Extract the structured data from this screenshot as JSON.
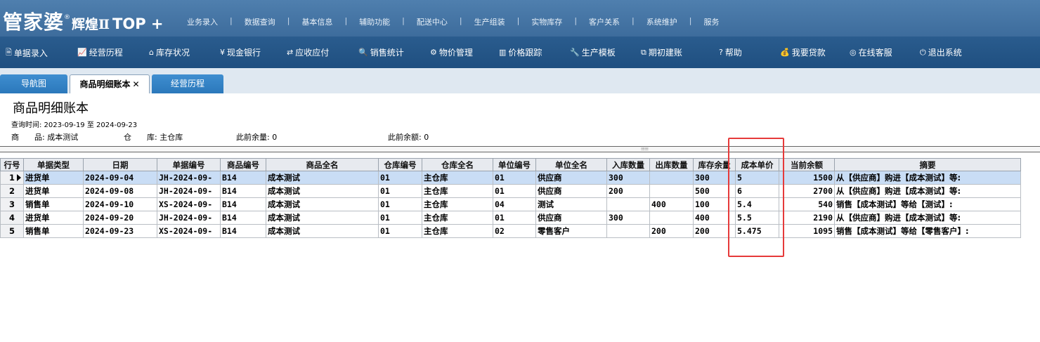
{
  "brand": {
    "main": "管家婆",
    "reg": "®",
    "sub": "辉煌Ⅱ",
    "top": "TOP +"
  },
  "topmenu": [
    "业务录入",
    "数据查询",
    "基本信息",
    "辅助功能",
    "配送中心",
    "生产组装",
    "实物库存",
    "客户关系",
    "系统维护",
    "服务"
  ],
  "toolbar": [
    {
      "icon": "document-icon",
      "glyph": "🗎",
      "label": "单据录入"
    },
    {
      "icon": "line-chart-icon",
      "glyph": "📈",
      "label": "经营历程"
    },
    {
      "icon": "home-icon",
      "glyph": "⌂",
      "label": "库存状况"
    },
    {
      "icon": "yen-icon",
      "glyph": "¥",
      "label": "现金银行"
    },
    {
      "icon": "exchange-icon",
      "glyph": "⇄",
      "label": "应收应付"
    },
    {
      "icon": "search-icon",
      "glyph": "🔍",
      "label": "销售统计"
    },
    {
      "icon": "gear-icon",
      "glyph": "⚙",
      "label": "物价管理"
    },
    {
      "icon": "bar-chart-icon",
      "glyph": "▥",
      "label": "价格跟踪"
    },
    {
      "icon": "wrench-icon",
      "glyph": "🔧",
      "label": "生产模板"
    },
    {
      "icon": "external-link-icon",
      "glyph": "⧉",
      "label": "期初建账"
    },
    {
      "icon": "help-icon",
      "glyph": "?",
      "label": "帮助"
    },
    {
      "icon": "money-bag-icon",
      "glyph": "💰",
      "label": "我要贷款"
    },
    {
      "icon": "support-icon",
      "glyph": "◎",
      "label": "在线客服"
    },
    {
      "icon": "power-icon",
      "glyph": "⏻",
      "label": "退出系统"
    }
  ],
  "tabs": [
    {
      "label": "导航图",
      "close": ""
    },
    {
      "label": "商品明细账本",
      "close": "✕"
    },
    {
      "label": "经营历程",
      "close": ""
    }
  ],
  "report": {
    "title": "商品明细账本",
    "query_time": "查询时间: 2023-09-19 至 2024-09-23",
    "product": "商　　品: 成本测试",
    "warehouse": "仓　　库: 主仓库",
    "prev_qty": "此前余量: 0",
    "prev_amount": "此前余额: 0",
    "grip": "⁝⁝⁝⁝⁝⁝⁝⁝ ⁝⁝⁝⁝⁝⁝⁝⁝"
  },
  "grid": {
    "headers": [
      "行号",
      "单据类型",
      "日期",
      "单据编号",
      "商品编号",
      "商品全名",
      "仓库编号",
      "仓库全名",
      "单位编号",
      "单位全名",
      "入库数量",
      "出库数量",
      "库存余量",
      "成本单价",
      "当前余额",
      "摘要"
    ],
    "rows": [
      [
        "1",
        "进货单",
        "2024-09-04",
        "JH-2024-09-",
        "B14",
        "成本测试",
        "01",
        "主仓库",
        "01",
        "供应商",
        "300",
        "",
        "300",
        "5",
        "1500",
        "从【供应商】购进【成本测试】等:"
      ],
      [
        "2",
        "进货单",
        "2024-09-08",
        "JH-2024-09-",
        "B14",
        "成本测试",
        "01",
        "主仓库",
        "01",
        "供应商",
        "200",
        "",
        "500",
        "6",
        "2700",
        "从【供应商】购进【成本测试】等:"
      ],
      [
        "3",
        "销售单",
        "2024-09-10",
        "XS-2024-09-",
        "B14",
        "成本测试",
        "01",
        "主仓库",
        "04",
        "测试",
        "",
        "400",
        "100",
        "5.4",
        "540",
        "销售【成本测试】等给【测试】:"
      ],
      [
        "4",
        "进货单",
        "2024-09-20",
        "JH-2024-09-",
        "B14",
        "成本测试",
        "01",
        "主仓库",
        "01",
        "供应商",
        "300",
        "",
        "400",
        "5.5",
        "2190",
        "从【供应商】购进【成本测试】等:"
      ],
      [
        "5",
        "销售单",
        "2024-09-23",
        "XS-2024-09-",
        "B14",
        "成本测试",
        "01",
        "主仓库",
        "02",
        "零售客户",
        "",
        "200",
        "200",
        "5.475",
        "1095",
        "销售【成本测试】等给【零售客户】:"
      ]
    ]
  }
}
